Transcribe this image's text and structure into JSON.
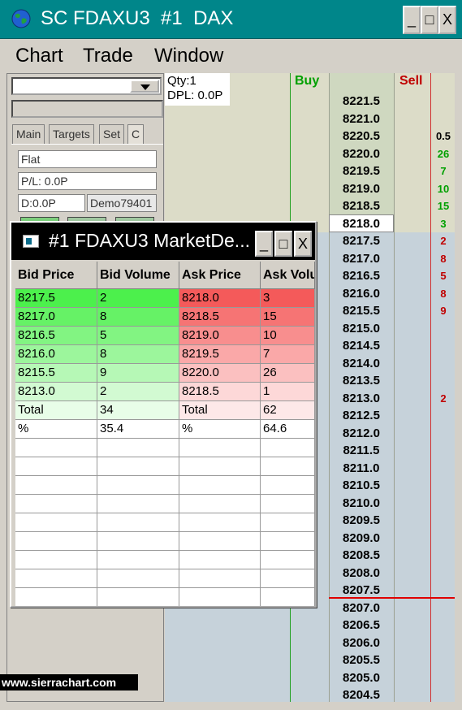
{
  "window": {
    "title": "SC FDAXU3  #1  DAX",
    "minimize": "_",
    "maximize": "□",
    "close": "X"
  },
  "menu": [
    "Chart",
    "Trade",
    "Window"
  ],
  "left_panel": {
    "tabs": [
      "Main",
      "Targets",
      "Set",
      "C"
    ],
    "position": "Flat",
    "pl": "P/L: 0.0P",
    "daily": "D:0.0P",
    "account": "Demo79401"
  },
  "dom": {
    "qty": "Qty:1",
    "dpl": "DPL: 0.0P",
    "buy_header": "Buy",
    "sell_header": "Sell",
    "current_price": "8218.0",
    "colors": {
      "buy": "#00a000",
      "sell": "#c00000",
      "line": "#e00000"
    },
    "prices": [
      "8221.5",
      "8221.0",
      "8220.5",
      "8220.0",
      "8219.5",
      "8219.0",
      "8218.5",
      "8218.0",
      "8217.5",
      "8217.0",
      "8216.5",
      "8216.0",
      "8215.5",
      "8215.0",
      "8214.5",
      "8214.0",
      "8213.5",
      "8213.0",
      "8212.5",
      "8212.0",
      "8211.5",
      "8211.0",
      "8210.5",
      "8210.0",
      "8209.5",
      "8209.0",
      "8208.5",
      "8208.0",
      "8207.5",
      "8207.0",
      "8206.5",
      "8206.0",
      "8205.5",
      "8205.0",
      "8204.5"
    ],
    "sell_qty": [
      {
        "row": 3,
        "value": "0.5",
        "color": "#000000"
      },
      {
        "row": 4,
        "value": "26",
        "color": "#00a000"
      },
      {
        "row": 5,
        "value": "7",
        "color": "#00a000"
      },
      {
        "row": 6,
        "value": "10",
        "color": "#00a000"
      },
      {
        "row": 7,
        "value": "15",
        "color": "#00a000"
      },
      {
        "row": 8,
        "value": "3",
        "color": "#00a000"
      },
      {
        "row": 9,
        "value": "2",
        "color": "#c00000"
      },
      {
        "row": 10,
        "value": "8",
        "color": "#c00000"
      },
      {
        "row": 11,
        "value": "5",
        "color": "#c00000"
      },
      {
        "row": 12,
        "value": "8",
        "color": "#c00000"
      },
      {
        "row": 13,
        "value": "9",
        "color": "#c00000"
      },
      {
        "row": 18,
        "value": "2",
        "color": "#c00000"
      }
    ]
  },
  "market_depth": {
    "title": "#1 FDAXU3 MarketDe...",
    "headers": [
      "Bid Price",
      "Bid Volume",
      "Ask Price",
      "Ask Volu"
    ],
    "rows": [
      [
        "8217.5",
        "2",
        "8218.0",
        "3"
      ],
      [
        "8217.0",
        "8",
        "8218.5",
        "15"
      ],
      [
        "8216.5",
        "5",
        "8219.0",
        "10"
      ],
      [
        "8216.0",
        "8",
        "8219.5",
        "7"
      ],
      [
        "8215.5",
        "9",
        "8220.0",
        "26"
      ],
      [
        "8213.0",
        "2",
        "8218.5",
        "1"
      ]
    ],
    "total": [
      "Total",
      "34",
      "Total",
      "62"
    ],
    "percent": [
      "%",
      "35.4",
      "%",
      "64.6"
    ],
    "bid_colors": [
      "#4cf04c",
      "#66f266",
      "#82f482",
      "#9cf69c",
      "#b6f8b6",
      "#d2fad2"
    ],
    "ask_colors": [
      "#f45a5a",
      "#f67474",
      "#f88e8e",
      "#faa8a8",
      "#fbc0c0",
      "#fdd8d8"
    ]
  },
  "watermark": "www.sierrachart.com"
}
